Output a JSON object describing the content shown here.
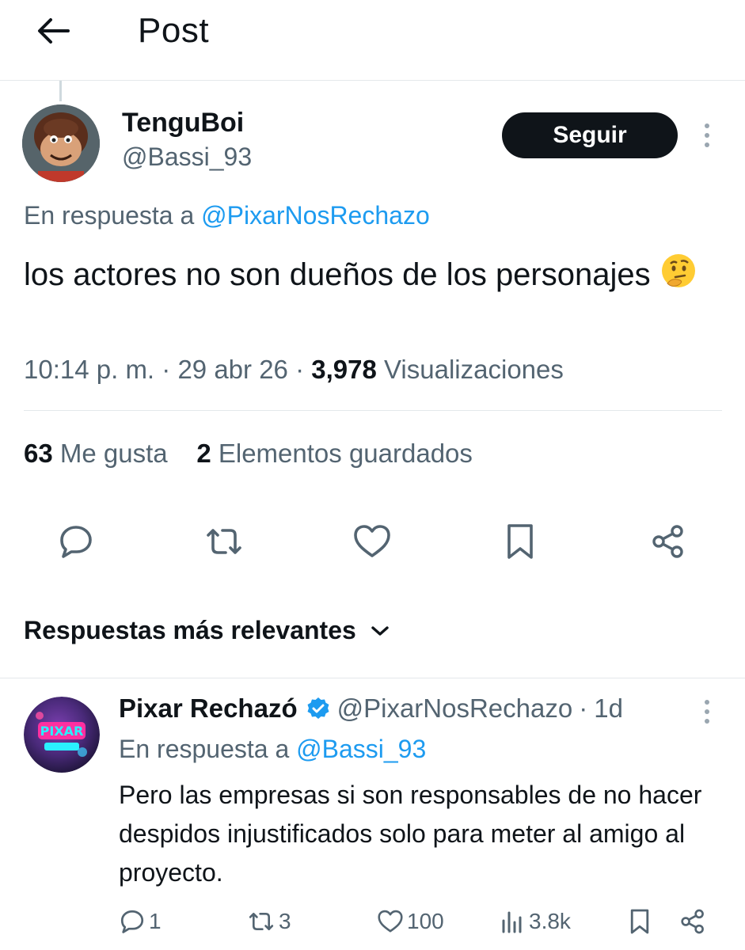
{
  "header": {
    "title": "Post",
    "back_icon": "arrow-left-icon"
  },
  "tweet": {
    "display_name": "TenguBoi",
    "handle": "@Bassi_93",
    "follow_label": "Seguir",
    "reply_prefix": "En respuesta a",
    "reply_mention": "@PixarNosRechazo",
    "text": "los actores no son dueños de los personajes",
    "emoji": "thinking-face-icon",
    "time": "10:14 p. m.",
    "date": "29 abr 26",
    "views_count": "3,978",
    "views_label": "Visualizaciones",
    "likes_count": "63",
    "likes_label": "Me gusta",
    "bookmarks_count": "2",
    "bookmarks_label": "Elementos guardados",
    "separator": "·"
  },
  "replies_section": {
    "sort_label": "Respuestas más relevantes"
  },
  "reply": {
    "display_name": "Pixar Rechazó",
    "handle": "@PixarNosRechazo",
    "age": "1d",
    "reply_prefix": "En respuesta a",
    "reply_mention": "@Bassi_93",
    "text": "Pero las empresas si son responsables de no hacer despidos injustificados solo para meter al amigo al proyecto.",
    "comments": "1",
    "retweets": "3",
    "likes": "100",
    "views": "3.8k",
    "avatar_text": "PIXAR"
  },
  "colors": {
    "accent": "#1d9bf0",
    "text": "#0f1419",
    "muted": "#536471",
    "button": "#0f1419"
  }
}
